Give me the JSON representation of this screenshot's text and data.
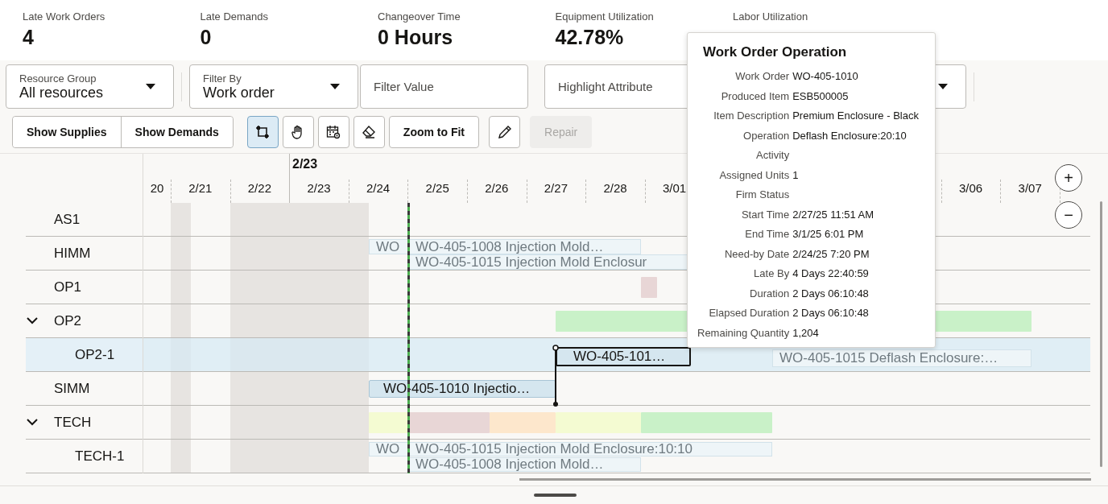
{
  "kpis": [
    {
      "label": "Late Work Orders",
      "value": "4"
    },
    {
      "label": "Late Demands",
      "value": "0"
    },
    {
      "label": "Changeover Time",
      "value": "0 Hours"
    },
    {
      "label": "Equipment Utilization",
      "value": "42.78%"
    },
    {
      "label": "Labor Utilization"
    }
  ],
  "filters": [
    {
      "kind": "select",
      "label": "Resource Group",
      "value": "All resources"
    },
    {
      "kind": "select",
      "label": "Filter By",
      "value": "Work order"
    },
    {
      "kind": "input",
      "placeholder": "Filter Value"
    },
    {
      "kind": "select",
      "placeholder": "Highlight Attribute"
    }
  ],
  "view_buttons": [
    "Show Supplies",
    "Show Demands"
  ],
  "tools": [
    {
      "kind": "select",
      "selected": true
    },
    {
      "kind": "pan",
      "selected": false
    },
    {
      "kind": "calendar",
      "selected": false
    },
    {
      "kind": "eraser",
      "selected": false
    },
    {
      "kind": "text",
      "label": "Zoom to Fit",
      "disabled": false
    },
    {
      "kind": "pencil",
      "selected": false
    },
    {
      "kind": "text",
      "label": "Repair",
      "disabled": true
    }
  ],
  "gantt": {
    "week_label": "2/23",
    "days": [
      "20",
      "2/21",
      "2/22",
      "2/23",
      "2/24",
      "2/25",
      "2/26",
      "2/27",
      "2/28",
      "3/01",
      "3/06",
      "3/07"
    ],
    "zoom_buttons": [
      "+",
      "−"
    ],
    "rows": [
      {
        "label": "AS1",
        "selected": false,
        "bars": []
      },
      {
        "label": "HIMM",
        "selected": false,
        "bars": [
          {
            "kind": "faded",
            "label": "WO"
          },
          {
            "kind": "faded",
            "label": "WO-405-1008 Injection Mold…"
          },
          {
            "kind": "faded",
            "label": "WO-405-1015 Injection Mold Enclosur"
          }
        ]
      },
      {
        "label": "OP1",
        "selected": false,
        "bars": [
          {
            "kind": "block",
            "color": "#e8d6d6"
          }
        ]
      },
      {
        "label": "OP2",
        "expanded": true,
        "selected": false,
        "bars": [
          {
            "kind": "block",
            "color": "#c9f1c8"
          }
        ],
        "children": [
          {
            "label": "OP2-1",
            "selected": true,
            "bars": [
              {
                "kind": "task",
                "label": "WO-405-101…",
                "selected": true
              },
              {
                "kind": "faded",
                "label": "WO-405-1015 Deflash Enclosure:…"
              }
            ]
          }
        ]
      },
      {
        "label": "SIMM",
        "selected": false,
        "bars": [
          {
            "kind": "task",
            "label": "WO-405-1010 Injectio…",
            "selected": false
          }
        ]
      },
      {
        "label": "TECH",
        "expanded": true,
        "selected": false,
        "bars": [
          {
            "kind": "block",
            "color": "#f4fbd2"
          },
          {
            "kind": "block",
            "color": "#e8d6d6"
          },
          {
            "kind": "block",
            "color": "#fde7cc"
          },
          {
            "kind": "block",
            "color": "#f4fbd2"
          },
          {
            "kind": "block",
            "color": "#c9f1c8"
          }
        ],
        "children": [
          {
            "label": "TECH-1",
            "selected": false,
            "bars": [
              {
                "kind": "faded",
                "label": "WO"
              },
              {
                "kind": "faded",
                "label": "WO-405-1015 Injection Mold Enclosure:10:10"
              },
              {
                "kind": "faded",
                "label": "WO-405-1008 Injection Mold…"
              }
            ]
          }
        ]
      }
    ]
  },
  "tooltip": {
    "title": "Work Order Operation",
    "fields": [
      {
        "label": "Work Order",
        "value": "WO-405-1010"
      },
      {
        "label": "Produced Item",
        "value": "ESB500005"
      },
      {
        "label": "Item Description",
        "value": "Premium Enclosure - Black"
      },
      {
        "label": "Operation",
        "value": "Deflash Enclosure:20:10"
      },
      {
        "label": "Activity"
      },
      {
        "label": "Assigned Units",
        "value": "1"
      },
      {
        "label": "Firm Status"
      },
      {
        "label": "Start Time",
        "value": "2/27/25 11:51 AM"
      },
      {
        "label": "End Time",
        "value": "3/1/25 6:01 PM"
      },
      {
        "label": "Need-by Date",
        "value": "2/24/25 7:20 PM"
      },
      {
        "label": "Late By",
        "value": "4 Days 22:40:59"
      },
      {
        "label": "Duration",
        "value": "2 Days 06:10:48"
      },
      {
        "label": "Elapsed Duration",
        "value": "2 Days 06:10:48"
      },
      {
        "label": "Remaining Quantity",
        "value": "1,204"
      }
    ]
  }
}
